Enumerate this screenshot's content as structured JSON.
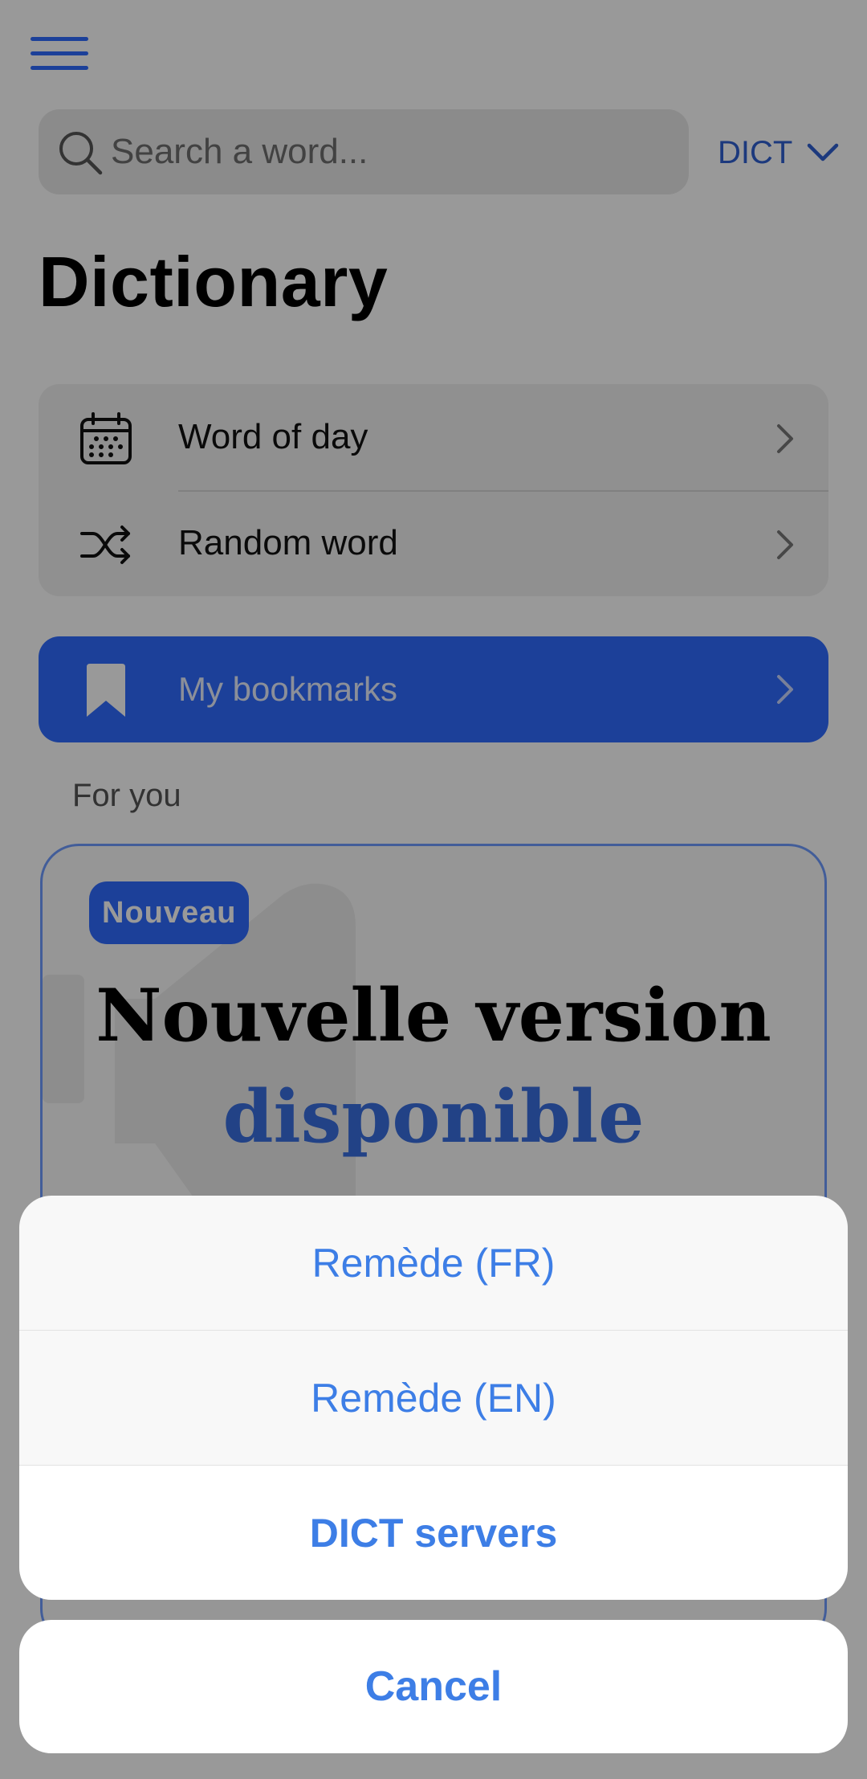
{
  "header": {
    "search_placeholder": "Search a word...",
    "dictionary_selector": "DICT"
  },
  "page_title": "Dictionary",
  "menu": {
    "word_of_day": "Word of day",
    "random_word": "Random word"
  },
  "bookmarks": {
    "label": "My bookmarks"
  },
  "section": {
    "for_you": "For you"
  },
  "promo": {
    "badge": "Nouveau",
    "title_line1": "Nouvelle version",
    "title_line2": "disponible"
  },
  "action_sheet": {
    "options": [
      "Remède (FR)",
      "Remède (EN)",
      "DICT servers"
    ],
    "cancel": "Cancel"
  },
  "colors": {
    "accent": "#2f6bff",
    "sheet_text": "#3d7ee6",
    "overlay": "rgba(0,0,0,0.40)"
  }
}
